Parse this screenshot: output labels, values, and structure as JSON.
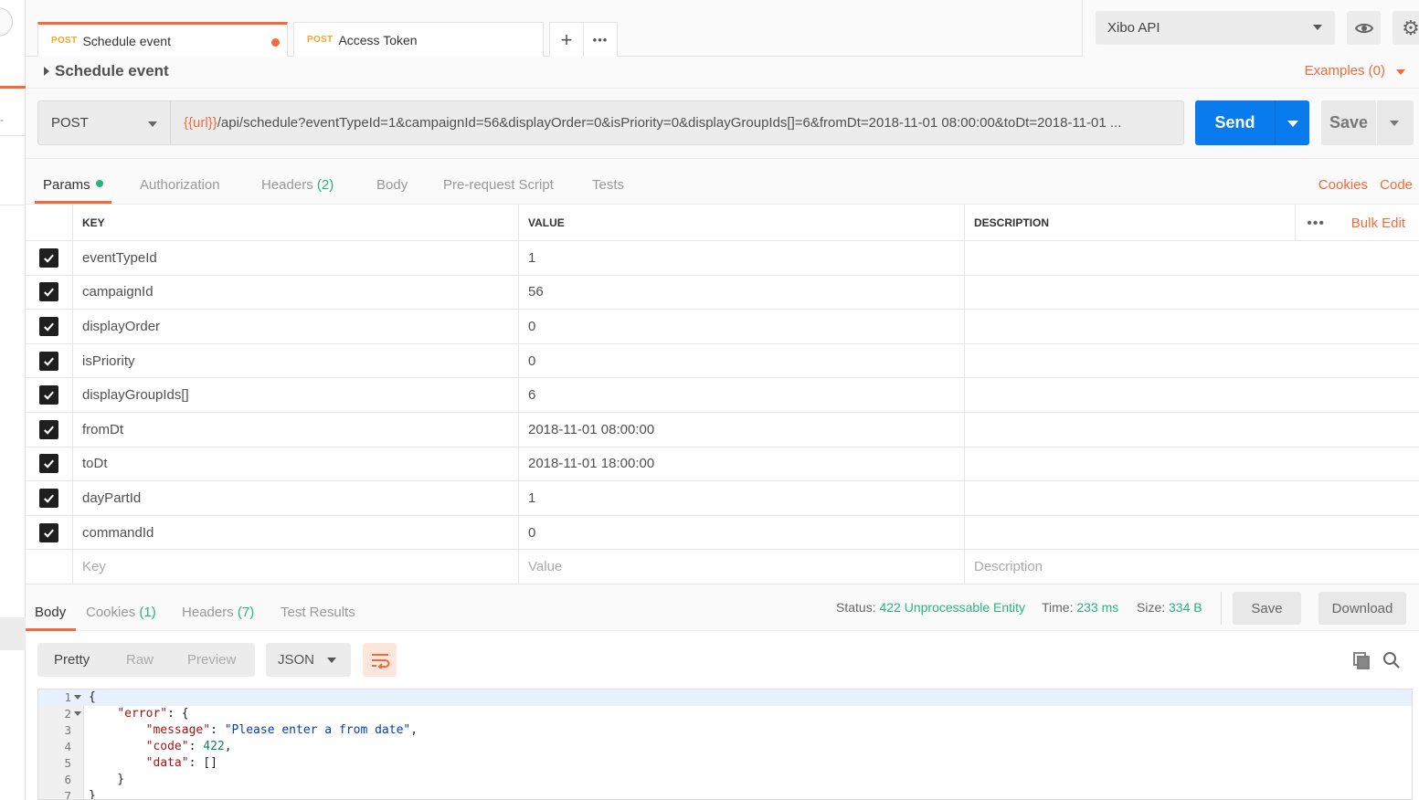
{
  "tabs": [
    {
      "method": "POST",
      "name": "Schedule event",
      "unsaved": true
    },
    {
      "method": "POST",
      "name": "Access Token",
      "unsaved": false
    }
  ],
  "tab_actions": {
    "add": "+",
    "more": "•••"
  },
  "environment": {
    "selected": "Xibo API"
  },
  "request": {
    "title": "Schedule event",
    "examples": "Examples (0)",
    "method": "POST",
    "url_var": "{{url}}",
    "url_rest": "/api/schedule?eventTypeId=1&campaignId=56&displayOrder=0&isPriority=0&displayGroupIds[]=6&fromDt=2018-11-01 08:00:00&toDt=2018-11-01 ...",
    "send_label": "Send",
    "save_label": "Save"
  },
  "request_tabs": {
    "params": "Params",
    "authorization": "Authorization",
    "headers": "Headers",
    "headers_count": "(2)",
    "body": "Body",
    "prerequest": "Pre-request Script",
    "tests": "Tests",
    "cookies": "Cookies",
    "code": "Code"
  },
  "params_table": {
    "headers": {
      "key": "KEY",
      "value": "VALUE",
      "description": "DESCRIPTION",
      "bulk_edit": "Bulk Edit",
      "more": "•••"
    },
    "rows": [
      {
        "key": "eventTypeId",
        "value": "1",
        "description": ""
      },
      {
        "key": "campaignId",
        "value": "56",
        "description": ""
      },
      {
        "key": "displayOrder",
        "value": "0",
        "description": ""
      },
      {
        "key": "isPriority",
        "value": "0",
        "description": ""
      },
      {
        "key": "displayGroupIds[]",
        "value": "6",
        "description": ""
      },
      {
        "key": "fromDt",
        "value": "2018-11-01 08:00:00",
        "description": ""
      },
      {
        "key": "toDt",
        "value": "2018-11-01 18:00:00",
        "description": ""
      },
      {
        "key": "dayPartId",
        "value": "1",
        "description": ""
      },
      {
        "key": "commandId",
        "value": "0",
        "description": ""
      }
    ],
    "placeholders": {
      "key": "Key",
      "value": "Value",
      "description": "Description"
    }
  },
  "response": {
    "tabs": {
      "body": "Body",
      "cookies": "Cookies",
      "cookies_count": "(1)",
      "headers": "Headers",
      "headers_count": "(7)",
      "test_results": "Test Results"
    },
    "status_label": "Status:",
    "status_value": "422 Unprocessable Entity",
    "time_label": "Time:",
    "time_value": "233 ms",
    "size_label": "Size:",
    "size_value": "334 B",
    "save_label": "Save",
    "download_label": "Download",
    "formats": {
      "pretty": "Pretty",
      "raw": "Raw",
      "preview": "Preview"
    },
    "language": "JSON",
    "code_lines": [
      "{",
      "    \"error\": {",
      "        \"message\": \"Please enter a from date\",",
      "        \"code\": 422,",
      "        \"data\": []",
      "    }",
      "}"
    ],
    "line_numbers": [
      "1",
      "2",
      "3",
      "4",
      "5",
      "6",
      "7"
    ]
  },
  "colors": {
    "accent": "#f26b3a",
    "send": "#097bed",
    "success": "#26b47f",
    "post_method": "#f5a623"
  }
}
